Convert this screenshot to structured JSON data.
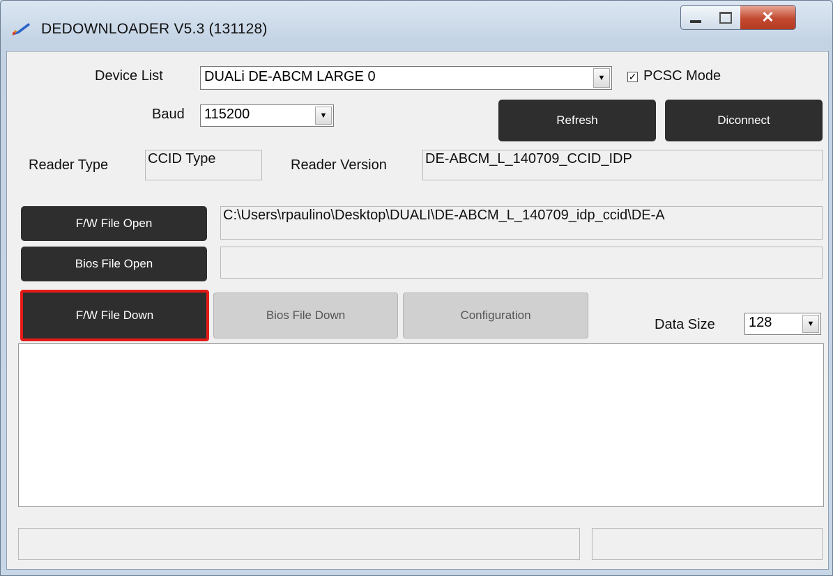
{
  "window": {
    "title": "DEDOWNLOADER V5.3 (131128)",
    "app_icon": "pen-icon",
    "controls": {
      "minimize": "minimize-icon",
      "maximize": "maximize-icon",
      "close": "✕"
    }
  },
  "device": {
    "device_list_label": "Device List",
    "device_list_value": "DUALi DE-ABCM LARGE 0",
    "pcsc_checked": true,
    "pcsc_label": "PCSC Mode",
    "baud_label": "Baud",
    "baud_value": "115200",
    "refresh_label": "Refresh",
    "disconnect_label": "Diconnect"
  },
  "reader": {
    "type_label": "Reader Type",
    "type_value": "CCID Type",
    "version_label": "Reader Version",
    "version_value": "DE-ABCM_L_140709_CCID_IDP"
  },
  "files": {
    "fw_open_label": "F/W File Open",
    "fw_path": "C:\\Users\\rpaulino\\Desktop\\DUALI\\DE-ABCM_L_140709_idp_ccid\\DE-A",
    "bios_open_label": "Bios File Open",
    "bios_path": ""
  },
  "actions": {
    "fw_down_label": "F/W File Down",
    "bios_down_label": "Bios File Down",
    "config_label": "Configuration",
    "data_size_label": "Data Size",
    "data_size_value": "128"
  },
  "log": {
    "text": ""
  },
  "status": {
    "left": "",
    "right": ""
  },
  "colors": {
    "highlight": "#e41b17",
    "dark_button": "#2e2e2e"
  }
}
